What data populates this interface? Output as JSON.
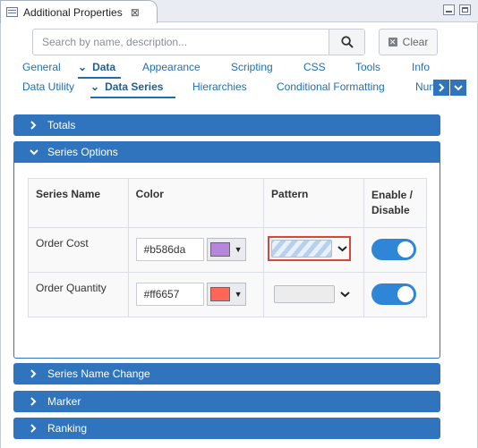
{
  "view": {
    "title": "Additional Properties",
    "close_glyph": "⊠"
  },
  "search": {
    "placeholder": "Search by name, description...",
    "clear_label": "Clear"
  },
  "nav": {
    "row1": [
      {
        "label": "General",
        "active": false
      },
      {
        "label": "Data",
        "active": true
      },
      {
        "label": "Appearance",
        "active": false
      },
      {
        "label": "Scripting",
        "active": false
      },
      {
        "label": "CSS",
        "active": false
      },
      {
        "label": "Tools",
        "active": false
      },
      {
        "label": "Info",
        "active": false
      }
    ],
    "row2": [
      {
        "label": "Data Utility",
        "active": false
      },
      {
        "label": "Data Series",
        "active": true
      },
      {
        "label": "Hierarchies",
        "active": false
      },
      {
        "label": "Conditional Formatting",
        "active": false
      },
      {
        "label": "Num",
        "active": false
      }
    ]
  },
  "sections": {
    "totals": "Totals",
    "series_options": "Series Options",
    "series_name_change": "Series Name Change",
    "marker": "Marker",
    "ranking": "Ranking"
  },
  "table": {
    "headers": {
      "name": "Series Name",
      "color": "Color",
      "pattern": "Pattern",
      "enable_line1": "Enable /",
      "enable_line2": "Disable"
    },
    "rows": [
      {
        "name": "Order Cost",
        "color": "#b586da",
        "pattern": "diagonal-stripes",
        "enabled": true,
        "pattern_selected": true
      },
      {
        "name": "Order Quantity",
        "color": "#ff6657",
        "pattern": "none",
        "enabled": true,
        "pattern_selected": false
      }
    ]
  },
  "icons": {
    "view_tab": "properties-icon",
    "search": "search-icon",
    "clear": "clear-x-icon",
    "collapsed": "chevron-right-icon",
    "expanded": "chevron-down-icon",
    "scroll_right": "chevron-right-icon",
    "scroll_down": "chevron-down-icon"
  },
  "colors": {
    "accent": "#2f74bd",
    "toggle_on": "#2f86d6",
    "highlight": "#d9453d"
  }
}
